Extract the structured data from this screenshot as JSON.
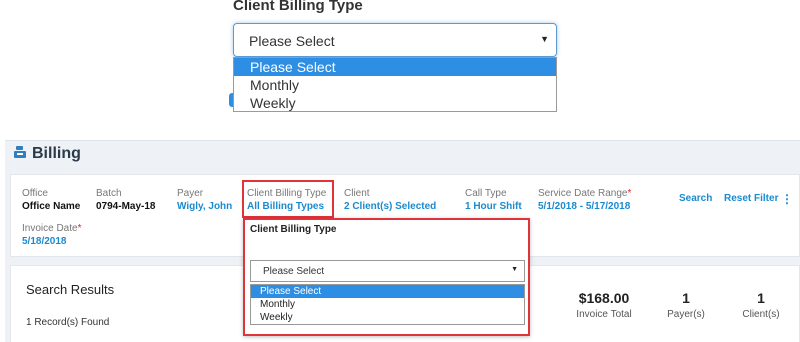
{
  "zoom": {
    "title": "Client Billing Type",
    "select_value": "Please Select",
    "options": [
      "Please Select",
      "Monthly",
      "Weekly"
    ]
  },
  "billing": {
    "title": "Billing",
    "filters": {
      "office": {
        "label": "Office",
        "value": "Office Name"
      },
      "batch": {
        "label": "Batch",
        "value": "0794-May-18"
      },
      "payer": {
        "label": "Payer",
        "value": "Wigly, John"
      },
      "client_billing_type": {
        "label": "Client Billing Type",
        "value": "All Billing Types"
      },
      "client": {
        "label": "Client",
        "value": "2 Client(s) Selected"
      },
      "call_type": {
        "label": "Call Type",
        "value": "1 Hour Shift"
      },
      "service_date_range": {
        "label": "Service Date Range",
        "value": "5/1/2018 - 5/17/2018"
      },
      "invoice_date": {
        "label": "Invoice Date",
        "value": "5/18/2018"
      }
    },
    "actions": {
      "search": "Search",
      "reset": "Reset Filter"
    },
    "results": {
      "title": "Search Results",
      "count": "1 Record(s) Found",
      "stats": [
        {
          "value": "$168.00",
          "label": "Invoice Total"
        },
        {
          "value": "1",
          "label": "Payer(s)"
        },
        {
          "value": "1",
          "label": "Client(s)"
        }
      ]
    },
    "popup": {
      "title": "Client Billing Type",
      "select_value": "Please Select",
      "options": [
        "Please Select",
        "Monthly",
        "Weekly"
      ]
    }
  },
  "colors": {
    "accent": "#2d8ee3",
    "link": "#1a8bd0",
    "highlight": "#e0343a",
    "panel_bg": "#eef1f5"
  }
}
